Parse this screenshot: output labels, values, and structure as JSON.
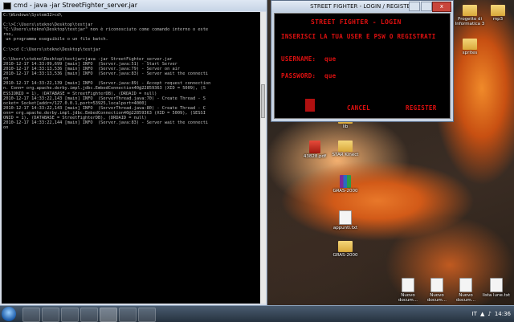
{
  "cmd": {
    "title": "cmd - java -jar StreetFighter_server.jar",
    "lines": [
      "C:\\Windows\\System32>cd\\",
      "",
      "C:\\>C:\\Users\\stekno\\Desktop\\testjar",
      "\"C:\\Users\\stekno\\Desktop\\testjar\" non è riconosciuto come comando interno o este",
      "rno,",
      " un programma eseguibile o un file batch.",
      "",
      "C:\\>cd C:\\Users\\stekno\\Desktop\\testjar",
      "",
      "C:\\Users\\stekno\\Desktop\\testjar>java -jar StreetFighter_server.jar",
      "2010-12-17 14:33:09,699 [main] INFO  (Server.java:51) - Start Server",
      "2010-12-17 14:33:13,536 [main] INFO  (Server.java:79) - Server on air",
      "2010-12-17 14:33:13,536 [main] INFO  (Server.java:83) - Server wait the connecti",
      "on",
      "2010-12-17 14:33:22,139 [main] INFO  (Server.java:89) - Accept request connection",
      "n. Conn= org.apache.derby.impl.jdbc.EmbedConnection40@22859363 (XID = 5009), (S",
      "ESSIONID = 1), (DATABASE = StreetFighterDB), (DRDAID = null)",
      "2010-12-17 14:33:22,143 [main] INFO  (ServerThread.java:70) - Create Thread - S",
      "ocket= Socket[addr=/127.0.0.1,port=53925,localport=4000]",
      "2010-12-17 14:33:22,143 [main] INFO  (ServerThread.java:80) - Create Thread - C",
      "onn= org.apache.derby.impl.jdbc.EmbedConnection40@22859363 (XID = 5009), (SESSI",
      "ONID = 1), (DATABASE = StreetFighterDB), (DRDAID = null)",
      "2010-12-17 14:33:22,144 [main] INFO  (Server.java:83) - Server wait the connecti",
      "on"
    ]
  },
  "game": {
    "title": "STREET FIGHTER - LOGIN / REGISTER",
    "heading": "STREET FIGHTER - LOGIN",
    "subheading": "INSERISCI LA TUA USER E PSW O REGISTRATI",
    "username_label": "USERNAME:",
    "username_value": "que",
    "password_label": "PASSWORD:",
    "password_value": "que",
    "cancel_label": "CANCEL",
    "register_label": "REGISTER",
    "close_glyph": "x"
  },
  "desktop_icons": [
    {
      "label": "Progetto di Informatica 3",
      "kind": "folder"
    },
    {
      "label": "mp3",
      "kind": "folder"
    },
    {
      "label": "sprites",
      "kind": "folder"
    },
    {
      "label": "lib",
      "kind": "folder"
    },
    {
      "label": "43828.pdf",
      "kind": "red"
    },
    {
      "label": "STAR Kinect",
      "kind": "folder"
    },
    {
      "label": "GRAS-2000",
      "kind": "rar"
    },
    {
      "label": "appunti.txt",
      "kind": "doc"
    },
    {
      "label": "GRAS-2000",
      "kind": "folder"
    },
    {
      "label": "Nuovo docum...",
      "kind": "doc"
    },
    {
      "label": "Nuovo docum...",
      "kind": "doc"
    },
    {
      "label": "Nuovo docum...",
      "kind": "doc"
    },
    {
      "label": "lista lune.txt",
      "kind": "doc"
    }
  ],
  "taskbar": {
    "clock": "14:36",
    "lang": "IT"
  }
}
